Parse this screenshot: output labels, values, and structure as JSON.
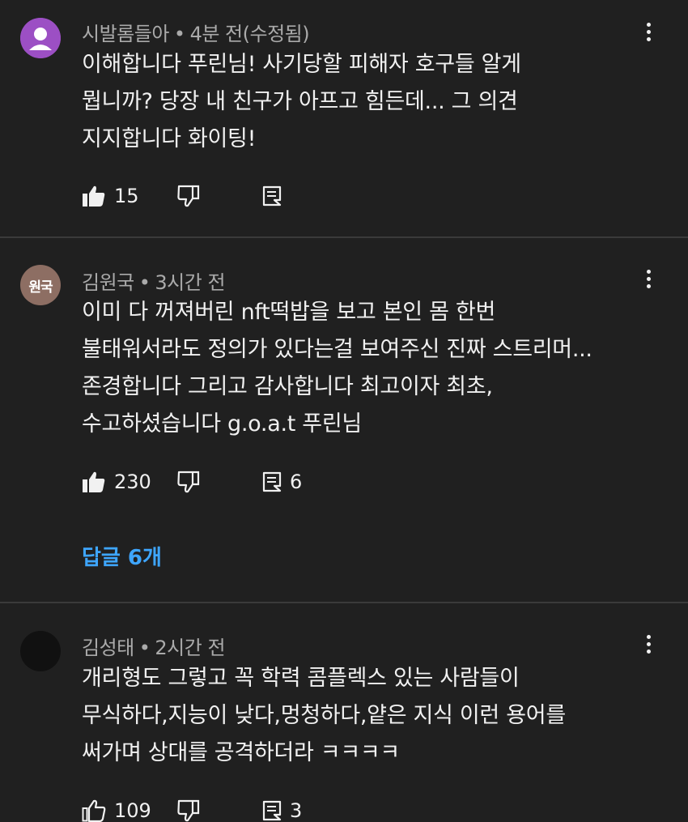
{
  "comments": [
    {
      "author": "시발롬들아",
      "time": "4분 전(수정됨)",
      "avatar_color": "#9c4fc4",
      "avatar_text": "",
      "lines": [
        "이해합니다 푸린님! 사기당할 피해자 호구들 알게",
        "뭡니까? 당장 내 친구가 아프고 힘든데... 그 의견",
        "지지합니다 화이팅!"
      ],
      "likes": "15",
      "liked": true,
      "replies_count": ""
    },
    {
      "author": "김원국",
      "time": "3시간 전",
      "avatar_color": "#8d6e63",
      "avatar_text": "원국",
      "lines": [
        "이미 다 꺼져버린 nft떡밥을 보고 본인 몸 한번",
        "불태워서라도 정의가 있다는걸 보여주신 진짜 스트리머...",
        "존경합니다 그리고 감사합니다 최고이자 최초,",
        "수고하셨습니다 g.o.a.t 푸린님"
      ],
      "likes": "230",
      "liked": true,
      "replies_count": "6",
      "replies_link": "답글 6개"
    },
    {
      "author": "김성태",
      "time": "2시간 전",
      "avatar_color": "#111111",
      "avatar_text": "",
      "lines": [
        "개리형도 그렇고 꼭 학력 콤플렉스 있는 사람들이",
        "무식하다,지능이 낮다,멍청하다,얕은 지식 이런 용어를",
        "써가며 상대를 공격하더라 ㅋㅋㅋㅋ"
      ],
      "likes": "109",
      "liked": false,
      "replies_count": "3"
    }
  ],
  "separator": "•",
  "icons": {
    "like": "thumbs-up-icon",
    "dislike": "thumbs-down-icon",
    "reply": "reply-comment-icon",
    "more": "more-vert-icon"
  },
  "colors": {
    "background": "#202020",
    "text": "#f1f1f1",
    "meta": "#aaaaaa",
    "link": "#3ea6ff"
  }
}
